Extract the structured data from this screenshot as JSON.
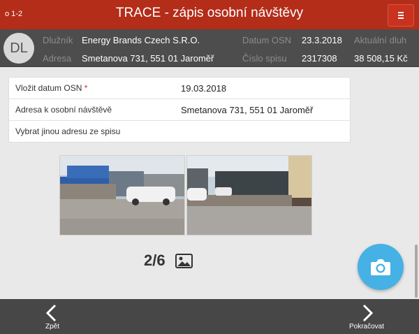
{
  "header": {
    "step": "o 1-2",
    "title": "TRACE - zápis osobní návštěvy",
    "menu_icon": "hamburger-menu-icon"
  },
  "colors": {
    "header_bg": "#b32d19",
    "infobar_bg": "#4d4d4d",
    "fab_bg": "#46b1e4",
    "bottombar_bg": "#474747",
    "required_star": "#d9271c"
  },
  "debtor": {
    "avatar_initials": "DL",
    "debtor_label": "Dlužník",
    "debtor_value": "Energy Brands Czech S.R.O.",
    "address_label": "Adresa",
    "address_value": "Smetanova 731, 551 01 Jaroměř",
    "osn_date_label": "Datum OSN",
    "osn_date_value": "23.3.2018",
    "file_no_label": "Číslo spisu",
    "file_no_value": "2317308",
    "debt_label": "Aktuální dluh",
    "debt_value": "38 508,15 Kč"
  },
  "form": {
    "rows": [
      {
        "label": "Vložit datum OSN",
        "required_mark": "*",
        "value": "19.03.2018"
      },
      {
        "label": "Adresa k osobní návštěvě",
        "value": "Smetanova 731, 551 01 Jaroměř"
      },
      {
        "label": "Vybrat jinou adresu ze spisu",
        "value": ""
      }
    ]
  },
  "gallery": {
    "counter": "2/6",
    "gallery_icon": "image-gallery-icon",
    "camera_icon": "camera-icon"
  },
  "footer": {
    "back_label": "Zpět",
    "back_icon": "chevron-left-icon",
    "next_label": "Pokračovat",
    "next_icon": "chevron-right-icon"
  }
}
